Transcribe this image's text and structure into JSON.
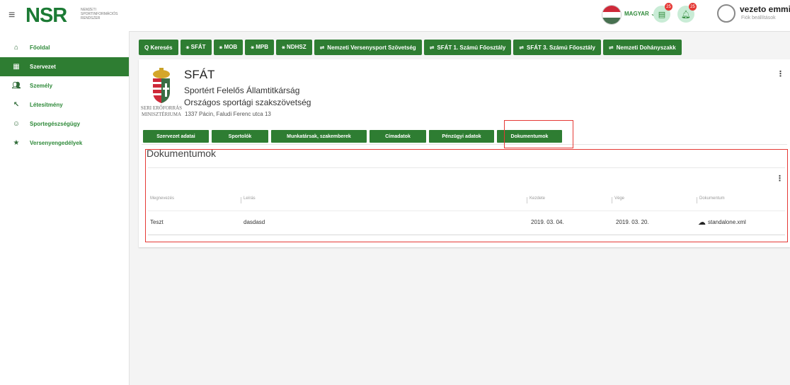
{
  "header": {
    "logo": "NSR",
    "logo_subtitle": "NEMZETI SPORTINFORMÁCIÓS RENDSZER",
    "language": "MAGYAR",
    "notif1_count": "25",
    "notif2_count": "25",
    "user_name": "vezeto emmi",
    "user_settings": "Fiók beállítások"
  },
  "sidebar": {
    "items": [
      {
        "label": "Főoldal",
        "icon": "home-icon"
      },
      {
        "label": "Szervezet",
        "icon": "building-icon"
      },
      {
        "label": "Személy",
        "icon": "people-icon"
      },
      {
        "label": "Létesítmény",
        "icon": "facility-icon"
      },
      {
        "label": "Sportegészségügy",
        "icon": "smile-icon"
      },
      {
        "label": "Versenyengedélyek",
        "icon": "star-icon"
      }
    ],
    "active_index": 1
  },
  "top_tabs": [
    "Q  Keresés",
    "⚹ SFÁT",
    "⚹ MOB",
    "⚹ MPB",
    "⚹ NDHSZ",
    "Nemzeti Versenysport Szövetség",
    "SFÁT 1. Számú Főosztály",
    "SFÁT 3. Számú Főosztály",
    "Nemzeti Dohányszakk"
  ],
  "org": {
    "short": "SFÁT",
    "name1": "Sportért Felelős Államtitkárság",
    "name2": "Országos sportági szakszövetség",
    "address": "1337 Pácin, Faludi Ferenc utca 13",
    "emblem_text": "SERI ERŐFORRÁS MINISZTÉRIUMA"
  },
  "sub_tabs": [
    "Szervezet adatai",
    "Sportolók",
    "Munkatársak, szakemberek",
    "Címadatok",
    "Pénzügyi adatok",
    "Dokumentumok"
  ],
  "documents": {
    "title": "Dokumentumok",
    "columns": [
      "Megnevezés",
      "Leírás",
      "Kezdete",
      "Vége",
      "Dokumentum"
    ],
    "rows": [
      {
        "name": "Teszt",
        "description": "dasdasd",
        "start": "2019. 03. 04.",
        "end": "2019. 03. 20.",
        "file": "standalone.xml"
      }
    ]
  },
  "colors": {
    "primary_green": "#2e7d32",
    "highlight_red": "#e53935"
  }
}
